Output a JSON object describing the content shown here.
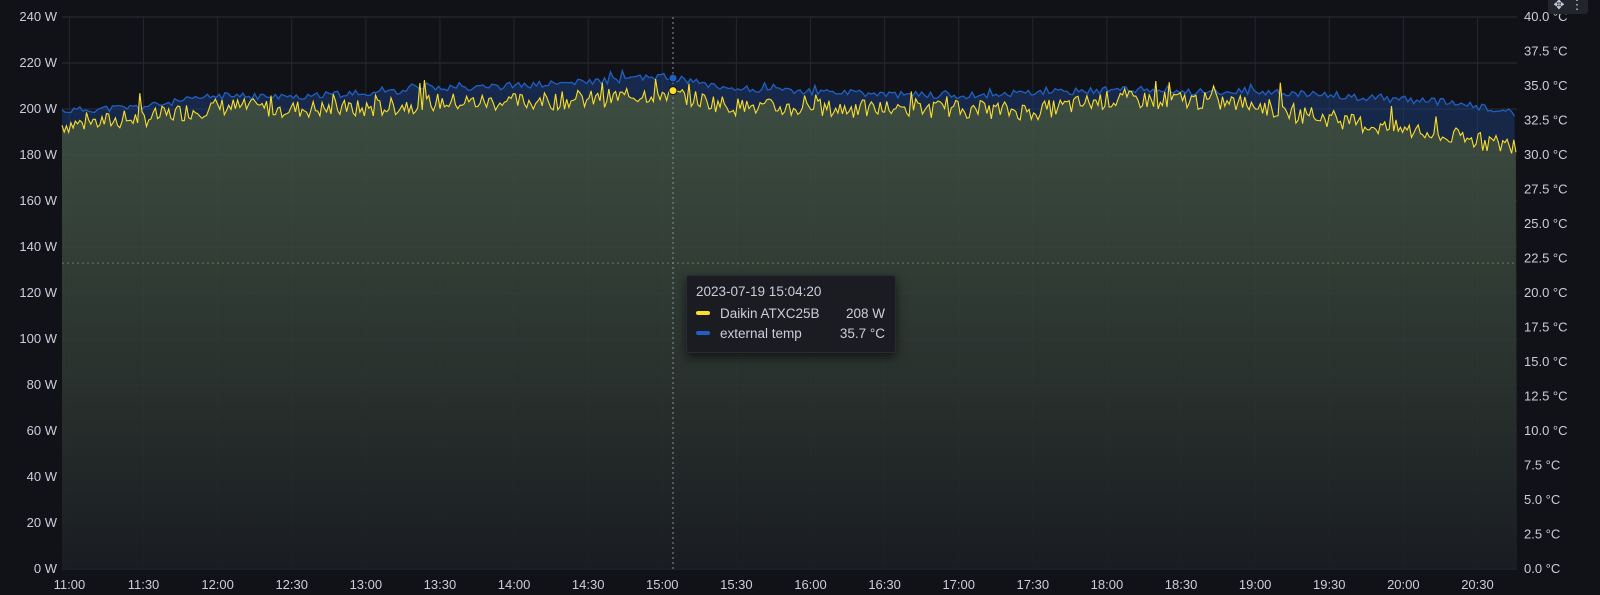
{
  "panel": {
    "tools": {
      "move_icon": "move-icon",
      "menu_icon": "kebab-menu-icon"
    }
  },
  "tooltip": {
    "time": "2023-07-19 15:04:20",
    "rows": [
      {
        "name": "Daikin ATXC25B",
        "value": "208 W",
        "color": "#fade2a"
      },
      {
        "name": "external temp",
        "value": "35.7 °C",
        "color": "#1f60c4"
      }
    ]
  },
  "chart_data": {
    "type": "line",
    "x_ticks": [
      "11:00",
      "11:30",
      "12:00",
      "12:30",
      "13:00",
      "13:30",
      "14:00",
      "14:30",
      "15:00",
      "15:30",
      "16:00",
      "16:30",
      "17:00",
      "17:30",
      "18:00",
      "18:30",
      "19:00",
      "19:30",
      "20:00",
      "20:30"
    ],
    "x_range": [
      "10:57",
      "20:46"
    ],
    "y_left": {
      "ticks": [
        "0 W",
        "20 W",
        "40 W",
        "60 W",
        "80 W",
        "100 W",
        "120 W",
        "140 W",
        "160 W",
        "180 W",
        "200 W",
        "220 W",
        "240 W"
      ],
      "range": [
        0,
        240
      ]
    },
    "y_right": {
      "ticks": [
        "0.0 °C",
        "2.5 °C",
        "5.0 °C",
        "7.5 °C",
        "10.0 °C",
        "12.5 °C",
        "15.0 °C",
        "17.5 °C",
        "20.0 °C",
        "22.5 °C",
        "25.0 °C",
        "27.5 °C",
        "30.0 °C",
        "32.5 °C",
        "35.0 °C",
        "37.5 °C",
        "40.0 °C"
      ],
      "range": [
        0,
        40
      ]
    },
    "series": [
      {
        "name": "Daikin ATXC25B",
        "axis": "left",
        "color": "#fade2a",
        "x": [
          "10:57",
          "11:30",
          "12:00",
          "12:30",
          "13:00",
          "13:30",
          "14:00",
          "14:30",
          "15:00",
          "15:30",
          "16:00",
          "16:30",
          "17:00",
          "17:30",
          "18:00",
          "18:30",
          "19:00",
          "19:15",
          "19:30",
          "19:45",
          "20:00",
          "20:15",
          "20:30",
          "20:46"
        ],
        "values": [
          193,
          196,
          201,
          200,
          200,
          203,
          203,
          204,
          207,
          201,
          200,
          200,
          200,
          199,
          204,
          204,
          202,
          198,
          196,
          193,
          191,
          188,
          186,
          184
        ]
      },
      {
        "name": "external temp",
        "axis": "right",
        "color": "#1f60c4",
        "x": [
          "10:57",
          "11:30",
          "12:00",
          "12:30",
          "13:00",
          "13:30",
          "14:00",
          "14:30",
          "15:00",
          "15:30",
          "16:00",
          "16:30",
          "17:00",
          "17:30",
          "18:00",
          "18:30",
          "19:00",
          "19:30",
          "20:00",
          "20:20",
          "20:46"
        ],
        "values": [
          33.2,
          33.5,
          34.3,
          34.2,
          34.5,
          34.9,
          35.0,
          35.3,
          35.7,
          34.8,
          34.6,
          34.4,
          34.3,
          34.5,
          34.7,
          34.6,
          34.6,
          34.3,
          34.0,
          33.8,
          33.0
        ]
      }
    ],
    "crosshair": {
      "time": "15:04:20"
    },
    "threshold_line": {
      "axis": "left",
      "value": 133
    },
    "grid": true,
    "legend": "hidden"
  }
}
